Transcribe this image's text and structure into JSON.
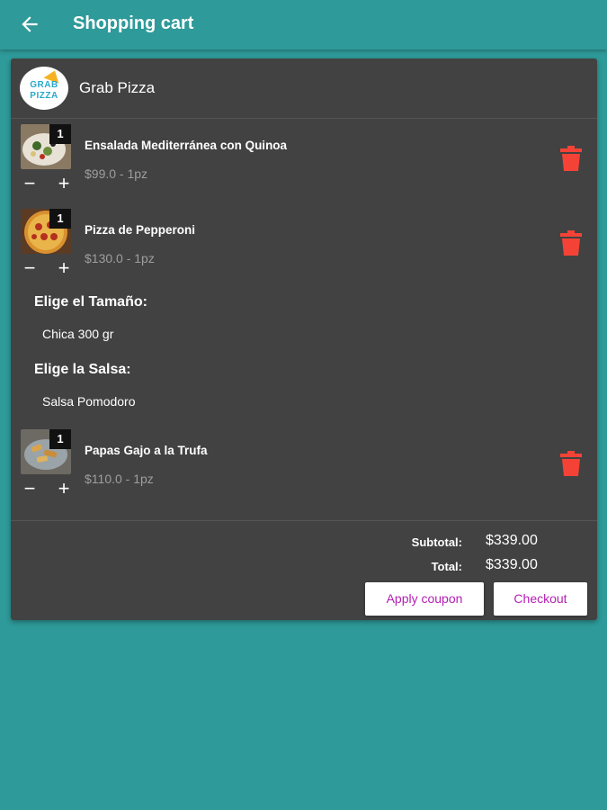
{
  "app_bar": {
    "title": "Shopping cart"
  },
  "store": {
    "name": "Grab Pizza",
    "logo_line1": "GRAB",
    "logo_line2": "PIZZA"
  },
  "items": [
    {
      "qty": "1",
      "name": "Ensalada Mediterránea con Quinoa",
      "price": "$99.0 - 1pz"
    },
    {
      "qty": "1",
      "name": "Pizza de Pepperoni",
      "price": "$130.0 - 1pz"
    },
    {
      "qty": "1",
      "name": "Papas Gajo a la Trufa",
      "price": "$110.0 - 1pz"
    }
  ],
  "item_options": [
    {
      "heading": "Elige el Tamaño:",
      "value": "Chica 300 gr"
    },
    {
      "heading": "Elige la Salsa:",
      "value": "Salsa Pomodoro"
    }
  ],
  "controls": {
    "minus": "−",
    "plus": "+"
  },
  "summary": {
    "subtotal_label": "Subtotal:",
    "subtotal_value": "$339.00",
    "total_label": "Total:",
    "total_value": "$339.00"
  },
  "buttons": {
    "apply_coupon": "Apply coupon",
    "checkout": "Checkout"
  },
  "colors": {
    "accent": "#2e9a99",
    "card": "#424242",
    "delete": "#f44336",
    "button_text": "#b41fb4"
  },
  "icons": {
    "back": "arrow-left-icon",
    "delete": "trash-icon"
  }
}
